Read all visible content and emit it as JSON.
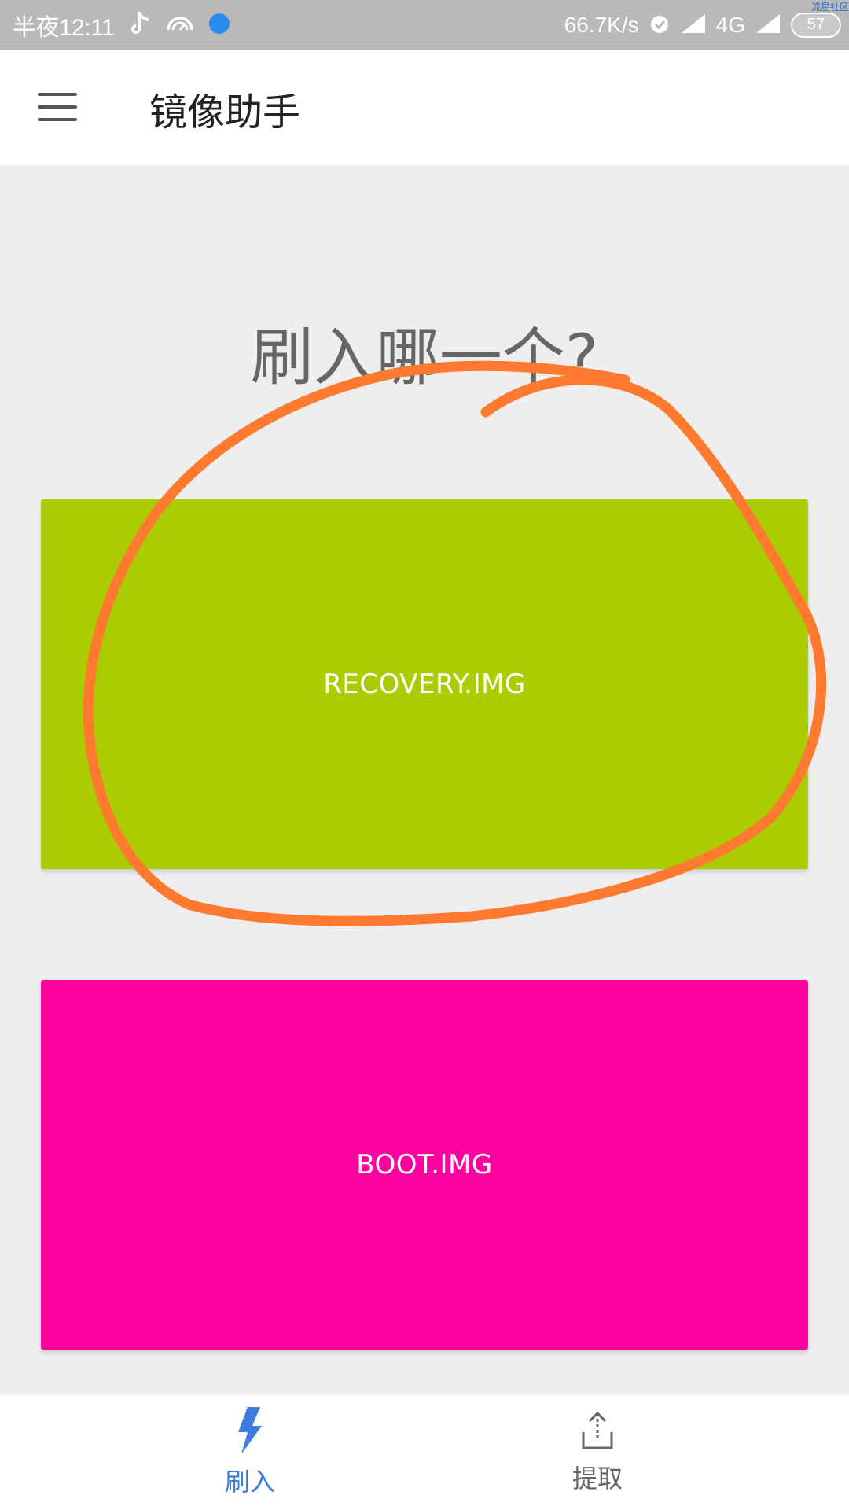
{
  "status_bar": {
    "time": "半夜12:11",
    "speed": "66.7K/s",
    "network": "4G",
    "battery": "57",
    "watermark": "流星社区",
    "icons": [
      "tiktok-icon",
      "speed-gauge-icon",
      "blue-dot-icon",
      "alarm-icon",
      "signal-icon",
      "signal-icon"
    ]
  },
  "app_bar": {
    "title": "镜像助手",
    "menu_icon": "menu-icon"
  },
  "main": {
    "question": "刷入哪一个?",
    "options": [
      {
        "label": "RECOVERY.IMG",
        "color": "#abcc00"
      },
      {
        "label": "BOOT.IMG",
        "color": "#fc029f"
      }
    ]
  },
  "bottom_nav": {
    "items": [
      {
        "label": "刷入",
        "icon": "flash-icon",
        "active": true,
        "color": "#3c7be0"
      },
      {
        "label": "提取",
        "icon": "upload-icon",
        "active": false,
        "color": "#666666"
      }
    ]
  },
  "annotation": {
    "color": "#ff7a2f"
  }
}
